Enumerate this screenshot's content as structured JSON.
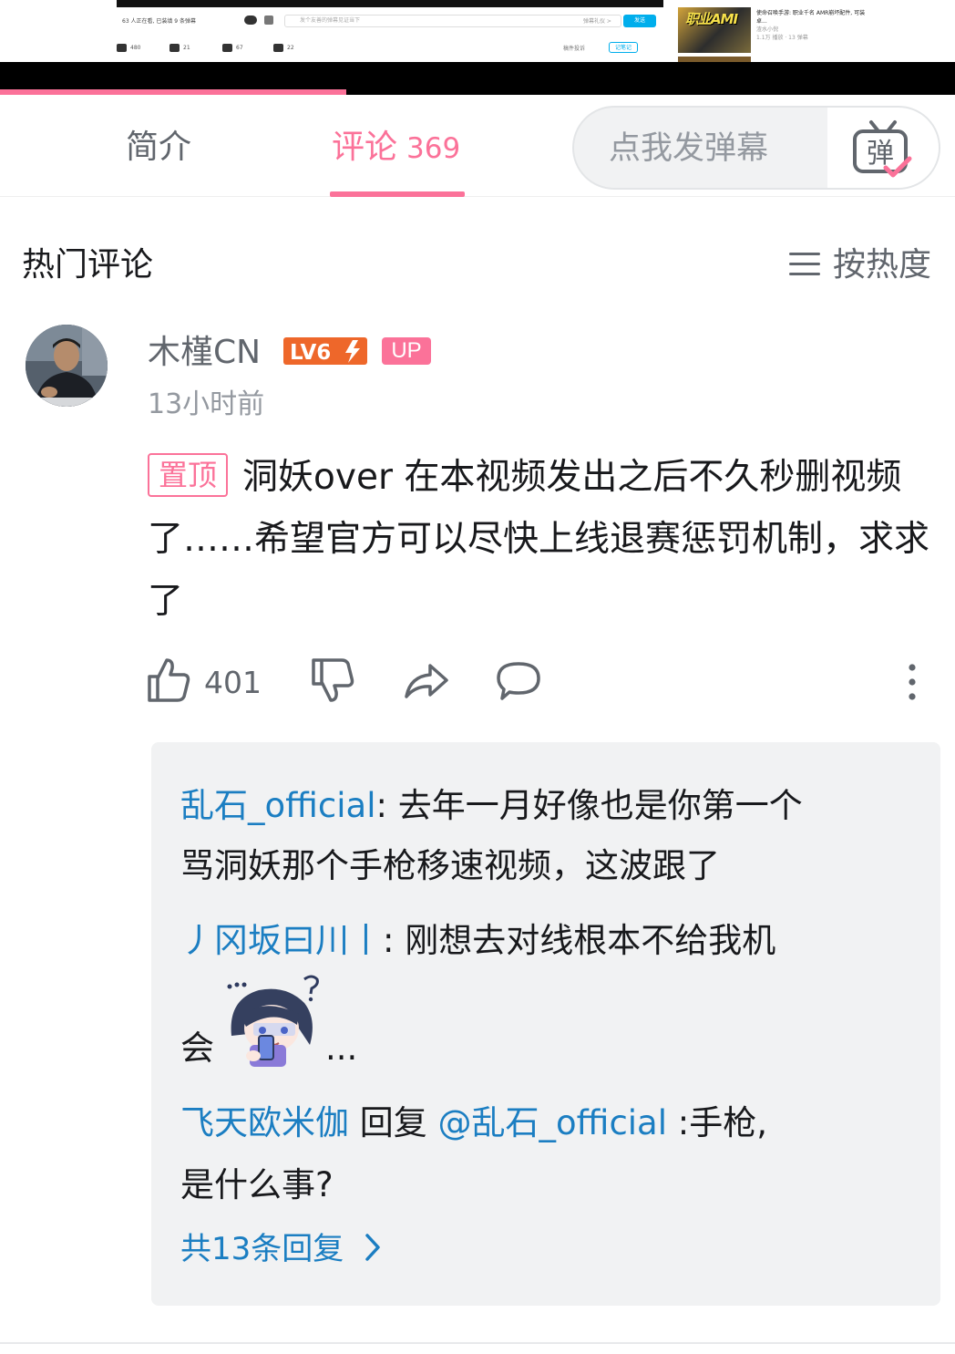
{
  "video_preview": {
    "online_text": "63 人正在看, 已装填 9 条弹幕",
    "danmaku_input_placeholder": "发个友善的弹幕见证当下",
    "danmaku_etiquette": "弹幕礼仪 >",
    "send_label": "发送",
    "stats": {
      "likes": "480",
      "coins": "21",
      "favorites": "67",
      "shares": "22"
    },
    "report_label": "稿件投诉",
    "notes_label": "记笔记",
    "recommended": {
      "thumb_text": "职业AMI",
      "title": "使命召唤手游: 职业千名 AMR崩坏配件, 可装卓...",
      "meta": "1.1万 播放 · 13 弹幕",
      "author": "渣水小倪"
    },
    "progress_fraction": 0.3626
  },
  "tabs": {
    "intro": "简介",
    "comments": "评论",
    "comments_count": "369"
  },
  "danmaku": {
    "placeholder": "点我发弹幕",
    "toggle_glyph": "弹"
  },
  "section": {
    "title": "热门评论",
    "sort_label": "按热度"
  },
  "comment": {
    "username": "木槿CN",
    "level": "LV6",
    "up_badge": "UP",
    "time": "13小时前",
    "pinned_label": "置顶",
    "text": "洞妖over 在本视频发出之后不久秒删视频了……希望官方可以尽快上线退赛惩罚机制，求求了",
    "likes": "401"
  },
  "replies": [
    {
      "user": "乱石_official",
      "line1": ": 去年一月好像也是你第一个",
      "line2": "骂洞妖那个手枪移速视频，这波跟了"
    },
    {
      "user": "丿冈坂曰川丨",
      "line1": ": 刚想去对线根本不给我机",
      "line2_pre": "会",
      "line2_post": "..."
    },
    {
      "user": "飞天欧米伽",
      "mid": " 回复 ",
      "mention": "@乱石_official",
      "line1_post": " :手枪,",
      "line2": "是什么事?"
    }
  ],
  "more_replies": "共13条回复",
  "colors": {
    "accent_pink": "#fb7299",
    "link_blue": "#1b7ec2",
    "text_gray": "#61666d",
    "muted_gray": "#9499a0",
    "reply_bg": "#f1f2f3"
  },
  "icons": [
    "thumb-up-icon",
    "thumb-down-icon",
    "share-icon",
    "comment-bubble-icon",
    "more-vertical-icon",
    "menu-lines-icon",
    "tv-danmaku-icon",
    "chevron-right-icon"
  ]
}
